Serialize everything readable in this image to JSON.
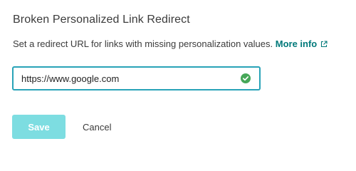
{
  "title": "Broken Personalized Link Redirect",
  "description": {
    "text": "Set a redirect URL for links with missing personalization values.",
    "link_label": "More info",
    "link_icon": "external-link-icon"
  },
  "redirect_field": {
    "value": "https://www.google.com",
    "status_icon": "check-circle-icon",
    "status_color": "#46a758",
    "focus_color": "#29a3b8"
  },
  "buttons": {
    "save_label": "Save",
    "cancel_label": "Cancel"
  },
  "colors": {
    "accent": "#00797a",
    "save_button_bg": "#7ddde1",
    "text": "#3b3b3b"
  }
}
